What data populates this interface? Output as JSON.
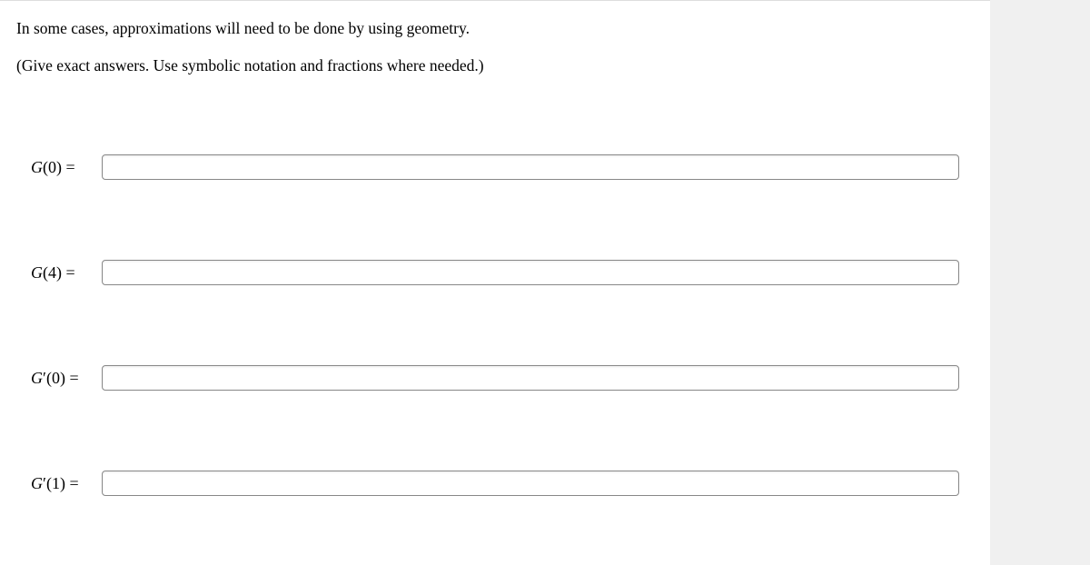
{
  "instructions": {
    "line1": "In some cases, approximations will need to be done by using geometry.",
    "line2": "(Give exact answers. Use symbolic notation and fractions where needed.)"
  },
  "fields": [
    {
      "label_func": "G",
      "label_prime": "",
      "label_arg": "0",
      "value": ""
    },
    {
      "label_func": "G",
      "label_prime": "",
      "label_arg": "4",
      "value": ""
    },
    {
      "label_func": "G",
      "label_prime": "′",
      "label_arg": "0",
      "value": ""
    },
    {
      "label_func": "G",
      "label_prime": "′",
      "label_arg": "1",
      "value": ""
    }
  ]
}
